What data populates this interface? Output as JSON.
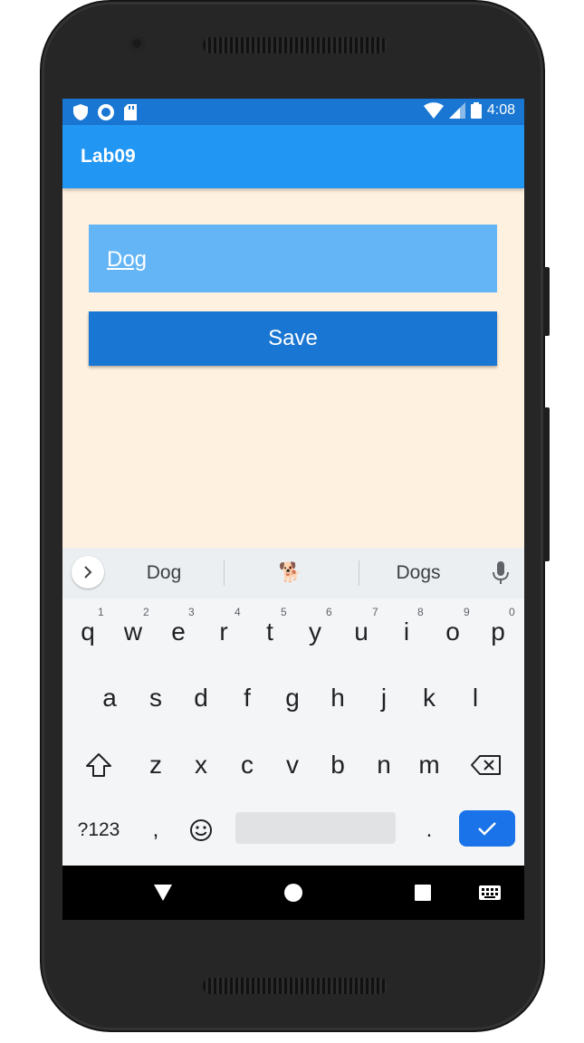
{
  "status_bar": {
    "time": "4:08",
    "left_icons": [
      "shield-icon",
      "circle-status-icon",
      "sd-card-icon"
    ],
    "right_icons": [
      "wifi-icon",
      "cell-signal-icon",
      "battery-icon"
    ]
  },
  "app_bar": {
    "title": "Lab09"
  },
  "form": {
    "entry_value": "Dog",
    "save_label": "Save"
  },
  "keyboard": {
    "suggestions": [
      "Dog",
      "🐕",
      "Dogs"
    ],
    "row1": [
      "q",
      "w",
      "e",
      "r",
      "t",
      "y",
      "u",
      "i",
      "o",
      "p"
    ],
    "row1_hints": [
      "1",
      "2",
      "3",
      "4",
      "5",
      "6",
      "7",
      "8",
      "9",
      "0"
    ],
    "row2": [
      "a",
      "s",
      "d",
      "f",
      "g",
      "h",
      "j",
      "k",
      "l"
    ],
    "row3": [
      "z",
      "x",
      "c",
      "v",
      "b",
      "n",
      "m"
    ],
    "symbols_label": "?123",
    "comma": ",",
    "period": "."
  },
  "colors": {
    "status_bar": "#1976d2",
    "app_bar": "#2196f3",
    "background": "#fff1df",
    "entry": "#64b5f6",
    "save_button": "#1976d2",
    "enter_key": "#1a73e8"
  }
}
